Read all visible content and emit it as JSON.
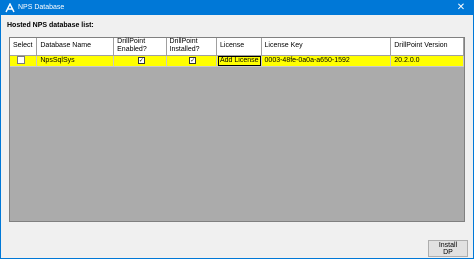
{
  "window": {
    "title": "NPS Database",
    "close_glyph": "✕"
  },
  "section": {
    "label": "Hosted NPS database list:"
  },
  "table": {
    "headers": {
      "select": "Select",
      "database_name": "Database Name",
      "drillpoint_enabled": "DrillPoint Enabled?",
      "drillpoint_installed": "DrillPoint Installed?",
      "license": "License",
      "license_key": "License Key",
      "drillpoint_version": "DrillPoint Version"
    },
    "rows": [
      {
        "selected": false,
        "database_name": "NpsSqlSys",
        "drillpoint_enabled": true,
        "drillpoint_installed": true,
        "license_button": "Add License",
        "license_key": "0003-48fe-0a0a-a650-1592",
        "drillpoint_version": "20.2.0.0"
      }
    ]
  },
  "buttons": {
    "install": "Install DP"
  },
  "icons": {
    "app": "app-logo-icon",
    "checkmark": "✓"
  },
  "colors": {
    "titlebar": "#0078d7",
    "row_highlight": "#ffff00",
    "grid_background": "#ababab"
  }
}
